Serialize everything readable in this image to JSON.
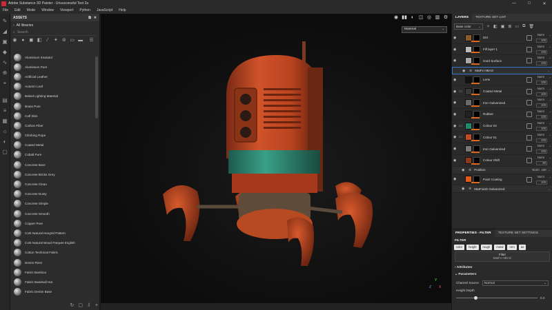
{
  "window": {
    "title": "Adobe Substance 3D Painter - Unsuccessful Test 2a",
    "controls": [
      "—",
      "□",
      "✕"
    ]
  },
  "menu": [
    "File",
    "Edit",
    "Mode",
    "Window",
    "Viewport",
    "Python",
    "JavaScript",
    "Help"
  ],
  "assets": {
    "header": "ASSETS",
    "libraries": "All libraries",
    "search_placeholder": "Search",
    "materials": [
      "Aluminium Insulator",
      "Aluminium Pure",
      "Artificial Leather",
      "Autumn Leaf",
      "Baked Lighting Material",
      "Brass Pure",
      "Calf Skin",
      "Carbon Fiber",
      "Climbing Rope",
      "Coated Metal",
      "Cobalt Pure",
      "Concrete Bare",
      "Concrete Bricks Grey",
      "Concrete Clean",
      "Concrete Dusty",
      "Concrete Simple",
      "Concrete Smooth",
      "Copper Pure",
      "Cork Natural Hexgrid Pattern",
      "Cork Natural Wood Parquet English",
      "Cotton Technical Fabric",
      "Denim Rivet",
      "Fabric Bamboo",
      "Fabric Baseball Hat",
      "Fabric Denim Base"
    ]
  },
  "viewport": {
    "display_mode": "Material",
    "axis": {
      "x": "X",
      "y": "Y",
      "z": "Z"
    }
  },
  "layers_panel": {
    "tabs": [
      "LAYERS",
      "TEXTURE SET LIST"
    ],
    "channel": "Base color",
    "layers": [
      {
        "name": "Dirt",
        "blend": "Norm",
        "opacity": "100",
        "thumb": "#8a5a2a",
        "type": "layer"
      },
      {
        "name": "Fill layer 1",
        "blend": "Norm",
        "opacity": "100",
        "thumb": "#bbbbbb",
        "type": "layer"
      },
      {
        "name": "Hard Surface",
        "blend": "Norm",
        "opacity": "100",
        "thumb": "#a8a8a8",
        "type": "layer"
      },
      {
        "name": "MatFx HBAO",
        "type": "effect",
        "selected": true
      },
      {
        "name": "Lens",
        "blend": "Norm",
        "opacity": "100",
        "thumb": "#111111",
        "type": "layer"
      },
      {
        "name": "Coated Metal",
        "blend": "Norm",
        "opacity": "100",
        "thumb": "#3a3a3a",
        "type": "folder"
      },
      {
        "name": "Iron Galvanized",
        "blend": "Norm",
        "opacity": "100",
        "thumb": "#6a6a6a",
        "type": "layer"
      },
      {
        "name": "Rubber",
        "blend": "Norm",
        "opacity": "100",
        "thumb": "#222222",
        "type": "layer"
      },
      {
        "name": "Colour 02",
        "blend": "Norm",
        "opacity": "100",
        "thumb": "#1f8a6e",
        "type": "folder"
      },
      {
        "name": "Colour 01",
        "blend": "Norm",
        "opacity": "100",
        "thumb": "#c24b22",
        "type": "folder"
      },
      {
        "name": "Iron Galvanized",
        "blend": "Norm",
        "opacity": "100",
        "thumb": "#777777",
        "type": "layer"
      },
      {
        "name": "Colour Shift",
        "blend": "Norm",
        "opacity": "80",
        "thumb": "#8a3a1a",
        "type": "layer"
      },
      {
        "name": "Position",
        "blend": "Norm",
        "opacity": "100",
        "type": "effect"
      },
      {
        "name": "Paint Coating",
        "blend": "Norm",
        "opacity": "100",
        "thumb": "#e05a1a",
        "type": "layer"
      },
      {
        "name": "MatFinish Galvanized",
        "type": "effect"
      }
    ]
  },
  "properties": {
    "tabs": [
      "PROPERTIES - FILTER",
      "TEXTURE SET SETTINGS"
    ],
    "filter_label": "FILTER",
    "chips": [
      "color",
      "height",
      "rough",
      "metal",
      "nrm",
      "ao"
    ],
    "filter_title": "Filter",
    "filter_value": "MatFx HBAO",
    "attributes": "Attributes",
    "parameters": "Parameters",
    "channel_source_label": "Channel Source",
    "channel_source_value": "Normal",
    "height_depth_label": "Height Depth",
    "height_depth_value": 0.2
  },
  "status": {
    "cache": "Cache Disk Usage:",
    "usage": "39%",
    "version": "Version: 7.4.1"
  },
  "colors": {
    "accent": "#e06a1b",
    "selection": "#3c7ad3",
    "robot_red": "#c0441f",
    "robot_teal": "#2c8a74"
  }
}
